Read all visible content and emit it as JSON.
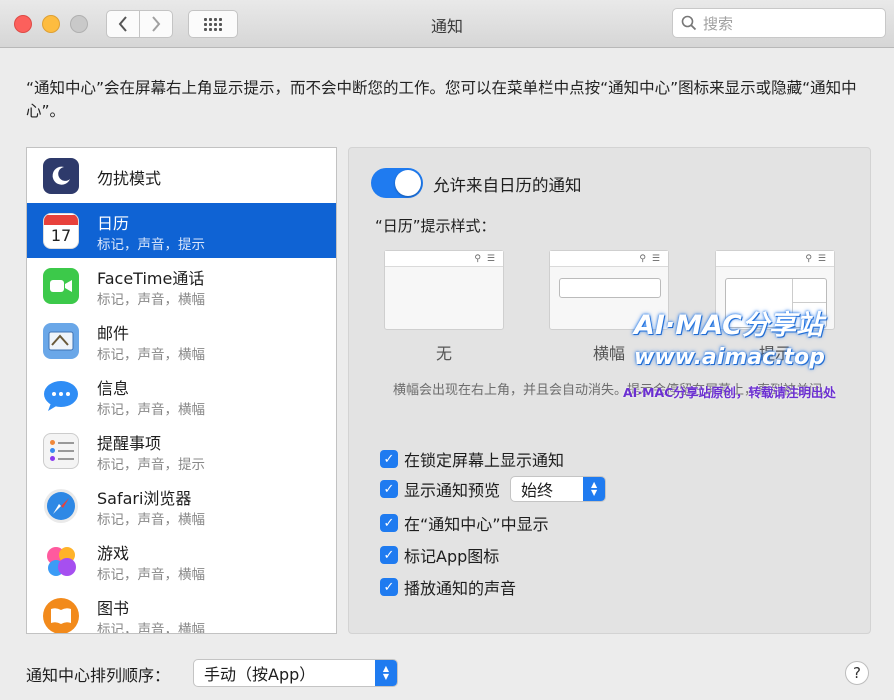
{
  "window": {
    "title": "通知",
    "search_placeholder": "搜索"
  },
  "description": "“通知中心”会在屏幕右上角显示提示，而不会中断您的工作。您可以在菜单栏中点按“通知中心”图标来显示或隐藏“通知中心”。",
  "sidebar": {
    "items": [
      {
        "name": "勿扰模式",
        "sub": "",
        "icon": "moon-icon",
        "color": "#2e3a6b"
      },
      {
        "name": "日历",
        "sub": "标记，声音，提示",
        "icon": "calendar-icon",
        "color": "#ffffff",
        "selected": true
      },
      {
        "name": "FaceTime通话",
        "sub": "标记，声音，横幅",
        "icon": "facetime-icon",
        "color": "#3cc94a"
      },
      {
        "name": "邮件",
        "sub": "标记，声音，横幅",
        "icon": "mail-icon",
        "color": "#6aa7e8"
      },
      {
        "name": "信息",
        "sub": "标记，声音，横幅",
        "icon": "messages-icon",
        "color": "#2f8df5"
      },
      {
        "name": "提醒事项",
        "sub": "标记，声音，提示",
        "icon": "reminders-icon",
        "color": "#f4f4f4"
      },
      {
        "name": "Safari浏览器",
        "sub": "标记，声音，横幅",
        "icon": "safari-icon",
        "color": "#2e88e5"
      },
      {
        "name": "游戏",
        "sub": "标记，声音，横幅",
        "icon": "game-center-icon",
        "color": "#ff6aa7"
      },
      {
        "name": "图书",
        "sub": "标记，声音，横幅",
        "icon": "books-icon",
        "color": "#f28a1b"
      }
    ]
  },
  "panel": {
    "allow_label": "允许来自日历的通知",
    "allow_enabled": true,
    "style_label": "“日历”提示样式：",
    "styles": [
      "无",
      "横幅",
      "提示"
    ],
    "banner_desc": "横幅会出现在右上角，并且会自动消失。提示会停留在屏幕上，直到被关闭。",
    "checkboxes": [
      {
        "label": "在锁定屏幕上显示通知",
        "checked": true
      },
      {
        "label": "显示通知预览",
        "checked": true
      },
      {
        "label": "在“通知中心”中显示",
        "checked": true
      },
      {
        "label": "标记App图标",
        "checked": true
      },
      {
        "label": "播放通知的声音",
        "checked": true
      }
    ],
    "preview_popup": "始终"
  },
  "footer": {
    "order_label": "通知中心排列顺序：",
    "order_value": "手动（按App）",
    "help_label": "?"
  },
  "watermark": {
    "line1": "AI·MAC分享站",
    "line2": "www.aimac.top",
    "line3": "AI·MAC分享站原创，转载请注明出处"
  },
  "colors": {
    "accent": "#1f7bf0",
    "selection": "#0f63d4"
  }
}
